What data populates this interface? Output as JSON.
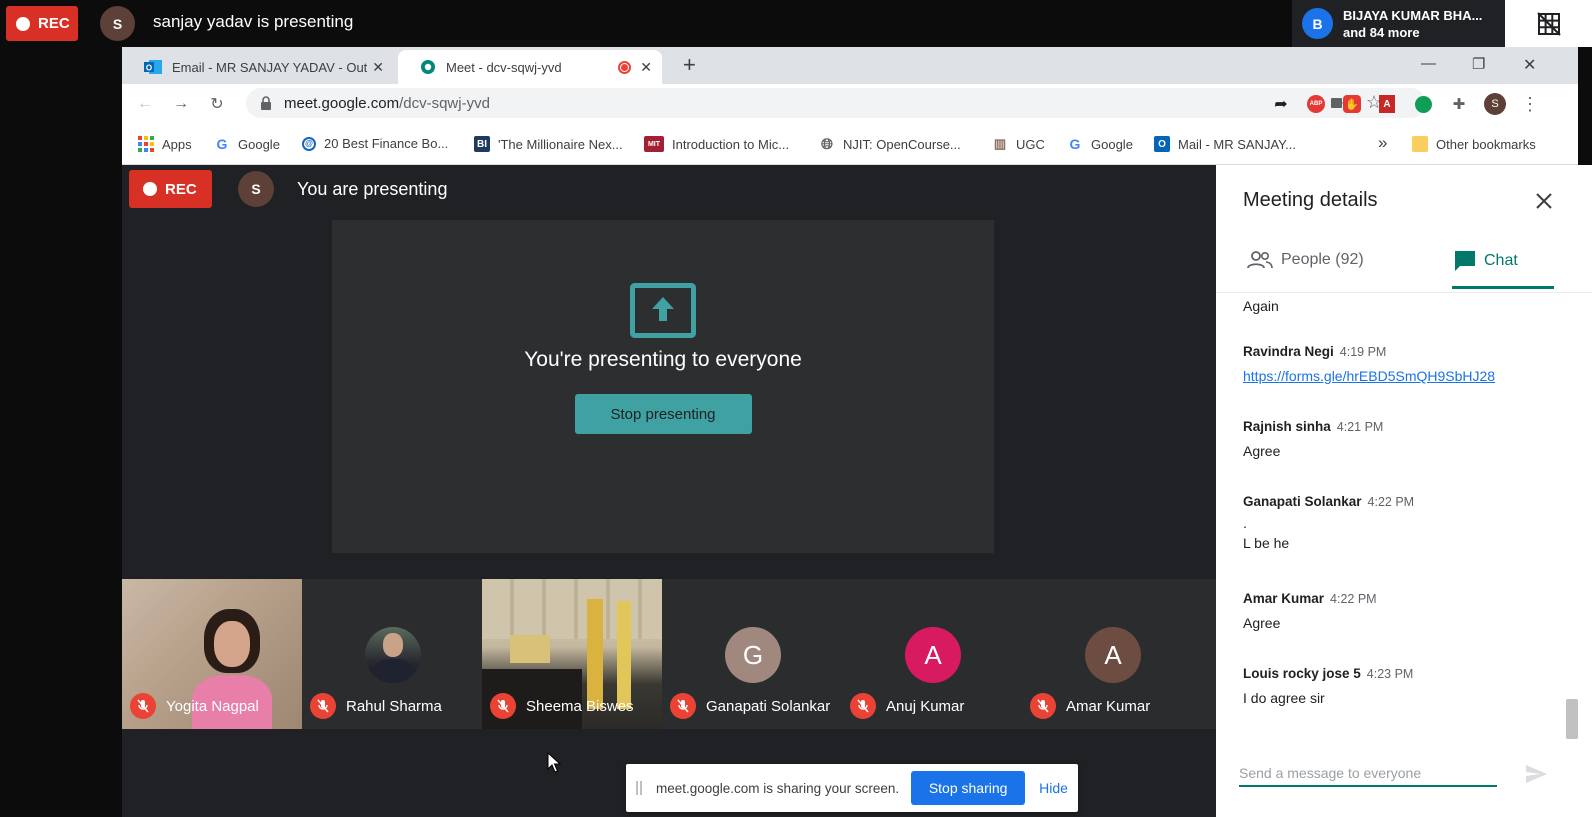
{
  "outer_bar": {
    "rec_label": "REC",
    "presenter_initial": "S",
    "presenter_text": "sanjay yadav is presenting",
    "viewer_initial": "B",
    "viewer_name": "BIJAYA KUMAR BHA...",
    "viewer_more": "and 84 more",
    "colors": {
      "rec": "#d93025",
      "presenter_avatar": "#5d4037",
      "viewer_avatar": "#1a73e8"
    }
  },
  "browser": {
    "tabs": [
      {
        "title": "Email - MR SANJAY YADAV - Out",
        "icon": "outlook-icon",
        "active": false
      },
      {
        "title": "Meet - dcv-sqwj-yvd",
        "icon": "meet-icon",
        "active": true
      }
    ],
    "new_tab_label": "+",
    "url_host": "meet.google.com",
    "url_path": "/dcv-sqwj-yvd",
    "profile_initial": "S",
    "bookmarks": [
      {
        "label": "Apps",
        "icon": "apps-grid-icon"
      },
      {
        "label": "Google",
        "icon": "google-icon"
      },
      {
        "label": "20 Best Finance Bo...",
        "icon": "finance-icon"
      },
      {
        "label": "'The Millionaire Nex...",
        "icon": "bi-icon"
      },
      {
        "label": "Introduction to Mic...",
        "icon": "mit-icon"
      },
      {
        "label": "NJIT: OpenCourse...",
        "icon": "globe-icon"
      },
      {
        "label": "UGC",
        "icon": "ugc-icon"
      },
      {
        "label": "Google",
        "icon": "google-icon"
      },
      {
        "label": "Mail - MR SANJAY...",
        "icon": "outlook-icon"
      }
    ],
    "more_bookmarks": "»",
    "other_bookmarks": "Other bookmarks"
  },
  "meet": {
    "rec_label": "REC",
    "self_initial": "S",
    "self_presenting": "You are presenting",
    "present_title": "You're presenting to everyone",
    "stop_presenting": "Stop presenting",
    "accent": "#3fa1a1",
    "participants": [
      {
        "name": "Yogita Nagpal",
        "initial": "",
        "type": "video-warm"
      },
      {
        "name": "Rahul Sharma",
        "initial": "",
        "type": "photo"
      },
      {
        "name": "Sheema Biswes",
        "initial": "",
        "type": "video-room"
      },
      {
        "name": "Ganapati Solankar",
        "initial": "G",
        "type": "avatar",
        "color": "#a1887f"
      },
      {
        "name": "Anuj Kumar",
        "initial": "A",
        "type": "avatar",
        "color": "#d81b60"
      },
      {
        "name": "Amar Kumar",
        "initial": "A",
        "type": "avatar",
        "color": "#6d4c41"
      }
    ]
  },
  "panel": {
    "title": "Meeting details",
    "people_tab": "People (92)",
    "chat_tab": "Chat",
    "chat_color": "#00796b",
    "partial_message": "Again",
    "messages": [
      {
        "sender": "Ravindra Negi",
        "time": "4:19 PM",
        "lines": [
          "https://forms.gle/hrEBD5SmQH9SbHJ28"
        ],
        "is_link": true
      },
      {
        "sender": "Rajnish sinha",
        "time": "4:21 PM",
        "lines": [
          "Agree"
        ]
      },
      {
        "sender": "Ganapati Solankar",
        "time": "4:22 PM",
        "lines": [
          ".",
          "L be he"
        ]
      },
      {
        "sender": "Amar Kumar",
        "time": "4:22 PM",
        "lines": [
          "Agree"
        ]
      },
      {
        "sender": "Louis rocky jose 5",
        "time": "4:23 PM",
        "lines": [
          "I do agree sir"
        ]
      }
    ],
    "input_placeholder": "Send a message to everyone"
  },
  "share_bar": {
    "message": "meet.google.com is sharing your screen.",
    "stop_sharing": "Stop sharing",
    "hide": "Hide"
  }
}
